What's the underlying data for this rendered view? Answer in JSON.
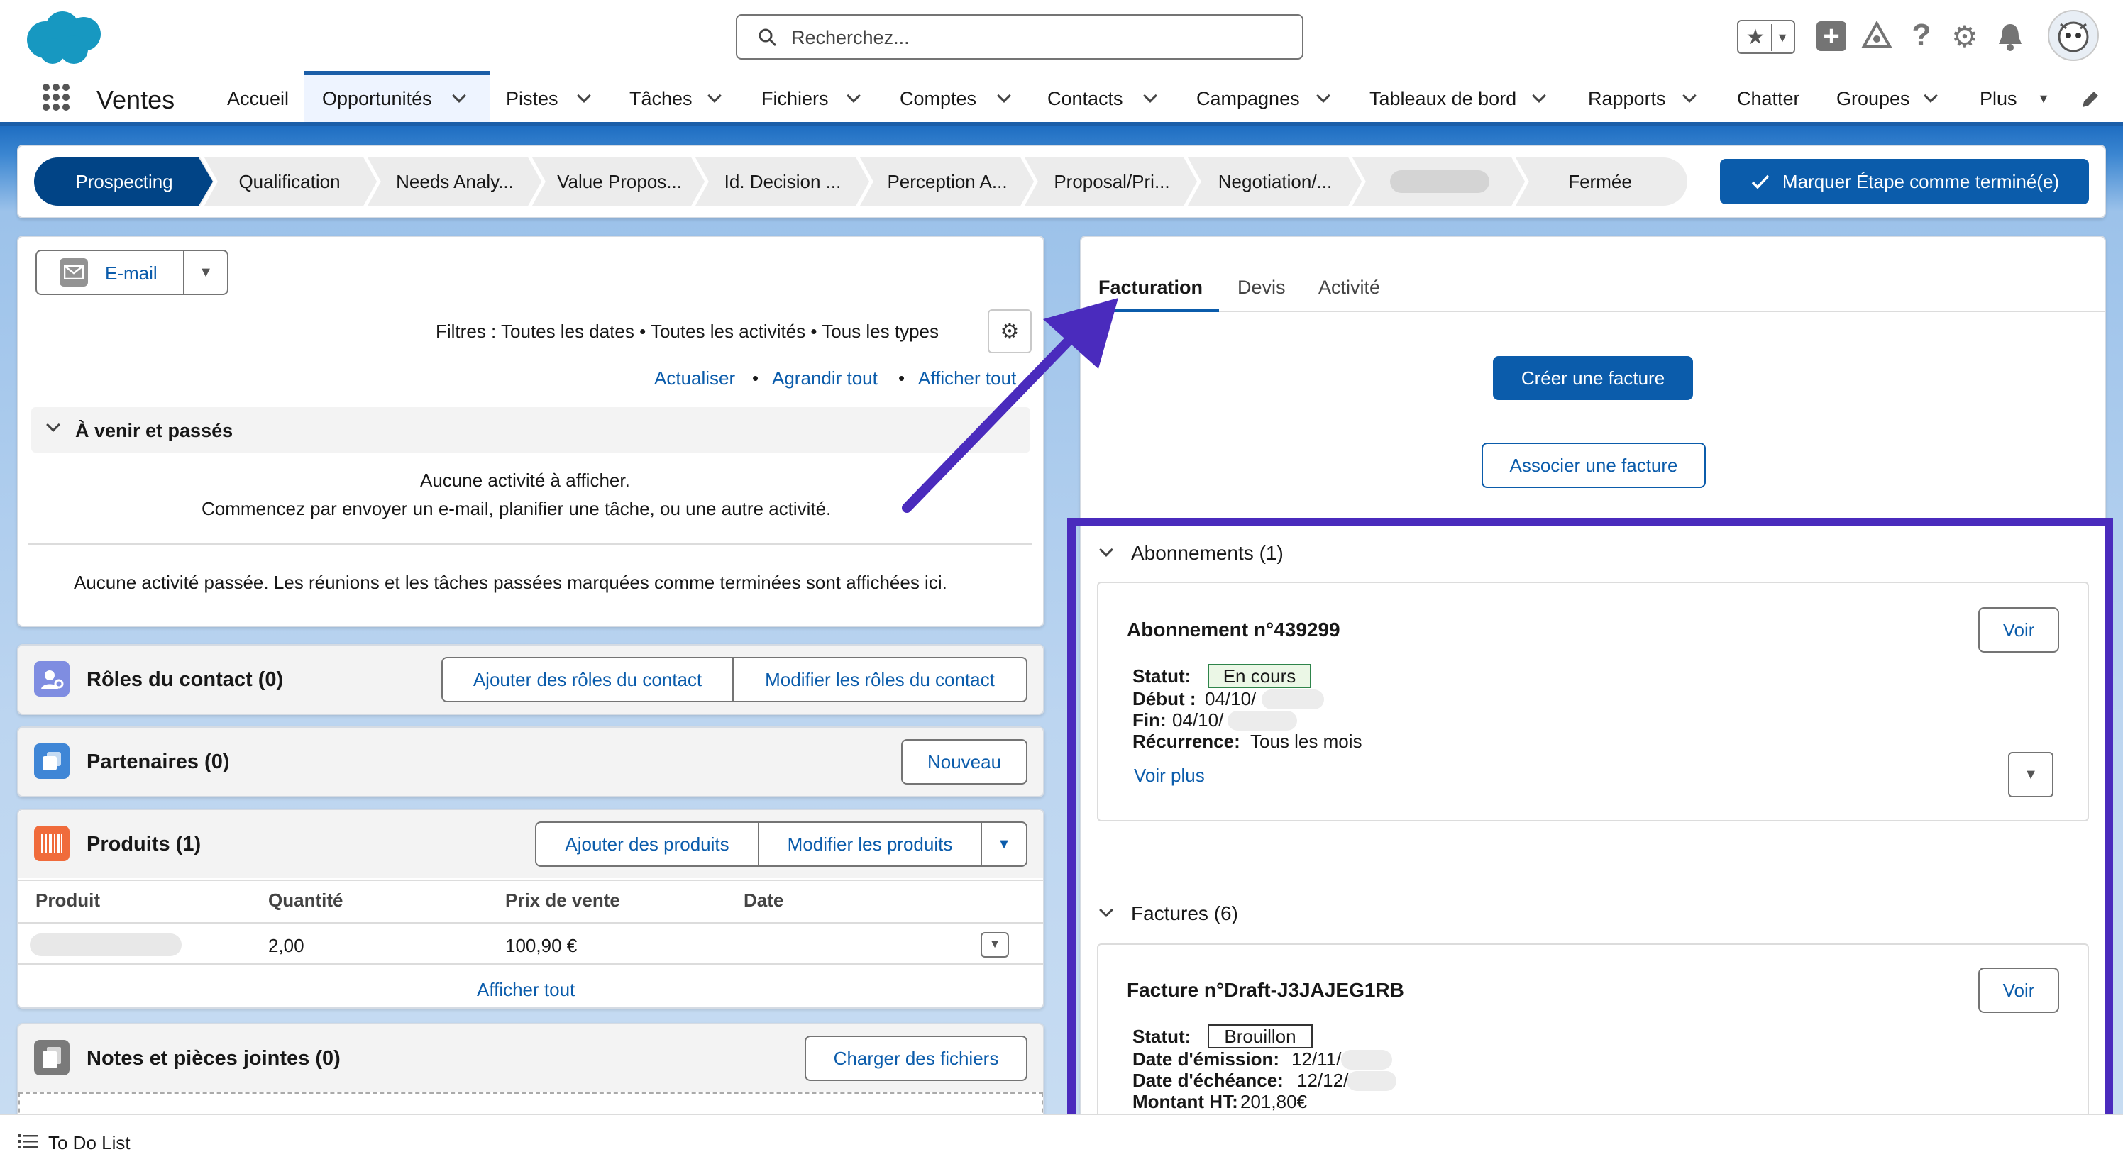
{
  "header": {
    "search_placeholder": "Recherchez...",
    "app_name": "Ventes"
  },
  "nav": {
    "items": [
      {
        "label": "Accueil"
      },
      {
        "label": "Opportunités"
      },
      {
        "label": "Pistes"
      },
      {
        "label": "Tâches"
      },
      {
        "label": "Fichiers"
      },
      {
        "label": "Comptes"
      },
      {
        "label": "Contacts"
      },
      {
        "label": "Campagnes"
      },
      {
        "label": "Tableaux de bord"
      },
      {
        "label": "Rapports"
      },
      {
        "label": "Chatter"
      },
      {
        "label": "Groupes"
      },
      {
        "label": "Plus"
      }
    ]
  },
  "path": {
    "steps": [
      "Prospecting",
      "Qualification",
      "Needs Analy...",
      "Value Propos...",
      "Id. Decision ...",
      "Perception A...",
      "Proposal/Pri...",
      "Negotiation/...",
      "",
      "Fermée"
    ],
    "complete_button": "Marquer Étape comme terminé(e)"
  },
  "activity": {
    "email_button": "E-mail",
    "filters": "Filtres : Toutes les dates • Toutes les activités • Tous les types",
    "refresh": "Actualiser",
    "expand_all": "Agrandir tout",
    "show_all": "Afficher tout",
    "sep": "•",
    "section_title": "À venir et passés",
    "empty_line1": "Aucune activité à afficher.",
    "empty_line2": "Commencez par envoyer un e-mail, planifier une tâche, ou une autre activité.",
    "past_empty": "Aucune activité passée. Les réunions et les tâches passées marquées comme terminées sont affichées ici."
  },
  "contact_roles": {
    "title": "Rôles du contact (0)",
    "add": "Ajouter des rôles du contact",
    "edit": "Modifier les rôles du contact"
  },
  "partners": {
    "title": "Partenaires (0)",
    "new": "Nouveau"
  },
  "products": {
    "title": "Produits (1)",
    "add": "Ajouter des produits",
    "edit": "Modifier les produits",
    "columns": [
      "Produit",
      "Quantité",
      "Prix de vente",
      "Date"
    ],
    "row": {
      "quantity": "2,00",
      "price": "100,90 €"
    },
    "show_all": "Afficher tout"
  },
  "notes": {
    "title": "Notes et pièces jointes (0)",
    "upload": "Charger des fichiers"
  },
  "todo": {
    "label": "To Do List"
  },
  "billing": {
    "tabs": [
      "Facturation",
      "Devis",
      "Activité"
    ],
    "create_invoice": "Créer une facture",
    "link_invoice": "Associer une facture",
    "subscriptions_title": "Abonnements (1)",
    "subscription": {
      "title": "Abonnement n°439299",
      "view": "Voir",
      "status_label": "Statut:",
      "status": "En cours",
      "start_label": "Début :",
      "start": "04/10/",
      "end_label": "Fin:",
      "end": "04/10/",
      "recurrence_label": "Récurrence:",
      "recurrence": "Tous les mois",
      "more": "Voir plus"
    },
    "invoices_title": "Factures (6)",
    "invoice": {
      "title": "Facture n°Draft-J3JAJEG1RB",
      "view": "Voir",
      "status_label": "Statut:",
      "status": "Brouillon",
      "issue_label": "Date d'émission:",
      "issue": "12/11/",
      "due_label": "Date d'échéance:",
      "due": "12/12/",
      "amount_label": "Montant HT:",
      "amount": "201,80€"
    }
  },
  "colors": {
    "brand": "#0b5cab",
    "annotation": "#4a2bbd",
    "path_active": "#014486",
    "status_green": "#2e844a"
  }
}
